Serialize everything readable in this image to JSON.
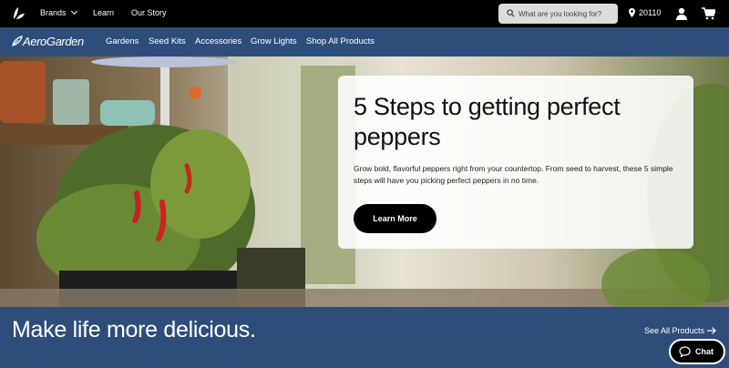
{
  "topbar": {
    "links": [
      {
        "label": "Brands"
      },
      {
        "label": "Learn"
      },
      {
        "label": "Our Story"
      }
    ],
    "search_placeholder": "What are you looking for?",
    "location": "20110",
    "icons": [
      "brand-leaf-icon",
      "chevron-down-icon",
      "search-icon",
      "location-pin-icon",
      "user-icon",
      "cart-icon"
    ]
  },
  "nav": {
    "logo": "AeroGarden",
    "items": [
      "Gardens",
      "Seed Kits",
      "Accessories",
      "Grow Lights",
      "Shop All Products"
    ]
  },
  "hero": {
    "title": "5 Steps to getting perfect peppers",
    "subtitle": "Grow bold, flavorful peppers right from your countertop. From seed to harvest, these 5 simple steps will have you picking perfect peppers in no time.",
    "cta": "Learn More"
  },
  "band": {
    "title": "Make life more delicious.",
    "see_all": "See All Products"
  },
  "chat": {
    "label": "Chat"
  },
  "colors": {
    "topbar": "#000000",
    "brand_blue": "#2f4d7a",
    "button": "#000000"
  }
}
